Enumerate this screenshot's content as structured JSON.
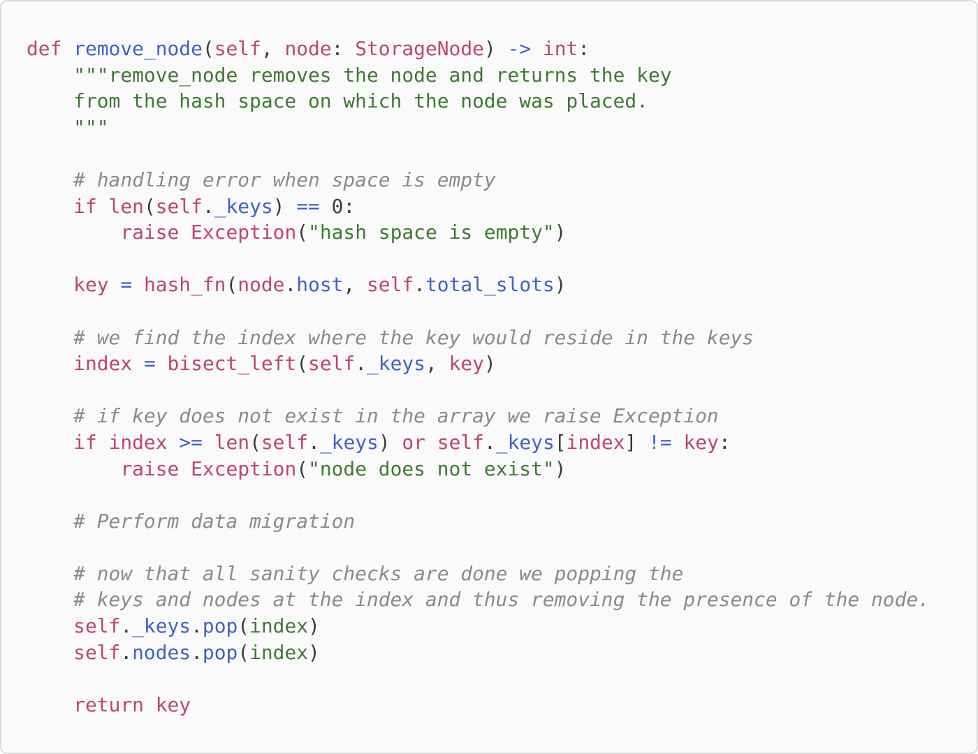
{
  "code_lines": [
    [
      {
        "t": "def ",
        "c": "kw"
      },
      {
        "t": "remove_node",
        "c": "fn"
      },
      {
        "t": "(",
        "c": "plain"
      },
      {
        "t": "self",
        "c": "kw"
      },
      {
        "t": ", ",
        "c": "plain"
      },
      {
        "t": "node",
        "c": "kw"
      },
      {
        "t": ": ",
        "c": "plain"
      },
      {
        "t": "StorageNode",
        "c": "kw"
      },
      {
        "t": ") ",
        "c": "plain"
      },
      {
        "t": "->",
        "c": "op"
      },
      {
        "t": " ",
        "c": "plain"
      },
      {
        "t": "int",
        "c": "kw"
      },
      {
        "t": ":",
        "c": "plain"
      }
    ],
    [
      {
        "t": "    \"\"\"remove_node removes the node and returns the key",
        "c": "str"
      }
    ],
    [
      {
        "t": "    from the hash space on which the node was placed.",
        "c": "str"
      }
    ],
    [
      {
        "t": "    \"\"\"",
        "c": "str"
      }
    ],
    [],
    [
      {
        "t": "    # handling error when space is empty",
        "c": "cmt"
      }
    ],
    [
      {
        "t": "    ",
        "c": "plain"
      },
      {
        "t": "if",
        "c": "kw"
      },
      {
        "t": " ",
        "c": "plain"
      },
      {
        "t": "len",
        "c": "kw"
      },
      {
        "t": "(",
        "c": "plain"
      },
      {
        "t": "self",
        "c": "kw"
      },
      {
        "t": ".",
        "c": "plain"
      },
      {
        "t": "_keys",
        "c": "fn"
      },
      {
        "t": ") ",
        "c": "plain"
      },
      {
        "t": "==",
        "c": "op"
      },
      {
        "t": " ",
        "c": "plain"
      },
      {
        "t": "0",
        "c": "num"
      },
      {
        "t": ":",
        "c": "plain"
      }
    ],
    [
      {
        "t": "        ",
        "c": "plain"
      },
      {
        "t": "raise",
        "c": "kw"
      },
      {
        "t": " ",
        "c": "plain"
      },
      {
        "t": "Exception",
        "c": "kw"
      },
      {
        "t": "(",
        "c": "plain"
      },
      {
        "t": "\"hash space is empty\"",
        "c": "str"
      },
      {
        "t": ")",
        "c": "plain"
      }
    ],
    [],
    [
      {
        "t": "    ",
        "c": "plain"
      },
      {
        "t": "key",
        "c": "kw"
      },
      {
        "t": " ",
        "c": "plain"
      },
      {
        "t": "=",
        "c": "op"
      },
      {
        "t": " ",
        "c": "plain"
      },
      {
        "t": "hash_fn",
        "c": "kw"
      },
      {
        "t": "(",
        "c": "plain"
      },
      {
        "t": "node",
        "c": "kw"
      },
      {
        "t": ".",
        "c": "plain"
      },
      {
        "t": "host",
        "c": "fn"
      },
      {
        "t": ", ",
        "c": "plain"
      },
      {
        "t": "self",
        "c": "kw"
      },
      {
        "t": ".",
        "c": "plain"
      },
      {
        "t": "total_slots",
        "c": "fn"
      },
      {
        "t": ")",
        "c": "plain"
      }
    ],
    [],
    [
      {
        "t": "    # we find the index where the key would reside in the keys",
        "c": "cmt"
      }
    ],
    [
      {
        "t": "    ",
        "c": "plain"
      },
      {
        "t": "index",
        "c": "kw"
      },
      {
        "t": " ",
        "c": "plain"
      },
      {
        "t": "=",
        "c": "op"
      },
      {
        "t": " ",
        "c": "plain"
      },
      {
        "t": "bisect_left",
        "c": "kw"
      },
      {
        "t": "(",
        "c": "plain"
      },
      {
        "t": "self",
        "c": "kw"
      },
      {
        "t": ".",
        "c": "plain"
      },
      {
        "t": "_keys",
        "c": "fn"
      },
      {
        "t": ", ",
        "c": "plain"
      },
      {
        "t": "key",
        "c": "kw"
      },
      {
        "t": ")",
        "c": "plain"
      }
    ],
    [],
    [
      {
        "t": "    # if key does not exist in the array we raise Exception",
        "c": "cmt"
      }
    ],
    [
      {
        "t": "    ",
        "c": "plain"
      },
      {
        "t": "if",
        "c": "kw"
      },
      {
        "t": " ",
        "c": "plain"
      },
      {
        "t": "index",
        "c": "kw"
      },
      {
        "t": " ",
        "c": "plain"
      },
      {
        "t": ">=",
        "c": "op"
      },
      {
        "t": " ",
        "c": "plain"
      },
      {
        "t": "len",
        "c": "kw"
      },
      {
        "t": "(",
        "c": "plain"
      },
      {
        "t": "self",
        "c": "kw"
      },
      {
        "t": ".",
        "c": "plain"
      },
      {
        "t": "_keys",
        "c": "fn"
      },
      {
        "t": ") ",
        "c": "plain"
      },
      {
        "t": "or",
        "c": "kw"
      },
      {
        "t": " ",
        "c": "plain"
      },
      {
        "t": "self",
        "c": "kw"
      },
      {
        "t": ".",
        "c": "plain"
      },
      {
        "t": "_keys",
        "c": "fn"
      },
      {
        "t": "[",
        "c": "plain"
      },
      {
        "t": "index",
        "c": "kw"
      },
      {
        "t": "] ",
        "c": "plain"
      },
      {
        "t": "!=",
        "c": "op"
      },
      {
        "t": " ",
        "c": "plain"
      },
      {
        "t": "key",
        "c": "kw"
      },
      {
        "t": ":",
        "c": "plain"
      }
    ],
    [
      {
        "t": "        ",
        "c": "plain"
      },
      {
        "t": "raise",
        "c": "kw"
      },
      {
        "t": " ",
        "c": "plain"
      },
      {
        "t": "Exception",
        "c": "kw"
      },
      {
        "t": "(",
        "c": "plain"
      },
      {
        "t": "\"node does not exist\"",
        "c": "str"
      },
      {
        "t": ")",
        "c": "plain"
      }
    ],
    [],
    [
      {
        "t": "    # Perform data migration",
        "c": "cmt"
      }
    ],
    [],
    [
      {
        "t": "    # now that all sanity checks are done we popping the",
        "c": "cmt"
      }
    ],
    [
      {
        "t": "    # keys and nodes at the index and thus removing the presence of the node.",
        "c": "cmt"
      }
    ],
    [
      {
        "t": "    ",
        "c": "plain"
      },
      {
        "t": "self",
        "c": "kw"
      },
      {
        "t": ".",
        "c": "plain"
      },
      {
        "t": "_keys",
        "c": "fn"
      },
      {
        "t": ".",
        "c": "plain"
      },
      {
        "t": "pop",
        "c": "fn"
      },
      {
        "t": "(",
        "c": "plain"
      },
      {
        "t": "index",
        "c": "str"
      },
      {
        "t": ")",
        "c": "plain"
      }
    ],
    [
      {
        "t": "    ",
        "c": "plain"
      },
      {
        "t": "self",
        "c": "kw"
      },
      {
        "t": ".",
        "c": "plain"
      },
      {
        "t": "nodes",
        "c": "fn"
      },
      {
        "t": ".",
        "c": "plain"
      },
      {
        "t": "pop",
        "c": "fn"
      },
      {
        "t": "(",
        "c": "plain"
      },
      {
        "t": "index",
        "c": "str"
      },
      {
        "t": ")",
        "c": "plain"
      }
    ],
    [],
    [
      {
        "t": "    ",
        "c": "plain"
      },
      {
        "t": "return",
        "c": "kw"
      },
      {
        "t": " ",
        "c": "plain"
      },
      {
        "t": "key",
        "c": "kw"
      }
    ]
  ]
}
